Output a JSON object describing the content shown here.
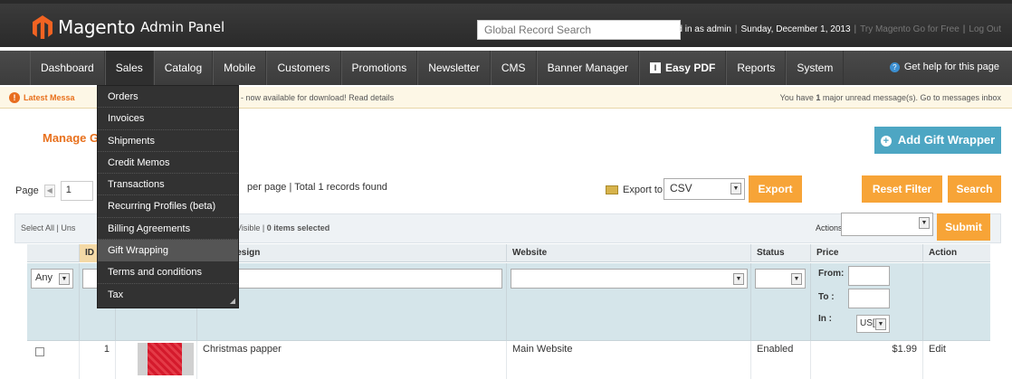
{
  "header": {
    "brand": "Magento",
    "brand_sub": "Admin Panel",
    "global_search_placeholder": "Global Record Search",
    "logged_in": "Logged in as admin",
    "date": "Sunday, December 1, 2013",
    "try_link": "Try Magento Go for Free",
    "logout": "Log Out"
  },
  "nav": {
    "items": [
      "Dashboard",
      "Sales",
      "Catalog",
      "Mobile",
      "Customers",
      "Promotions",
      "Newsletter",
      "CMS",
      "Banner Manager",
      "Easy PDF",
      "Reports",
      "System"
    ],
    "help": "Get help for this page"
  },
  "messages": {
    "latest": "Latest Messa",
    "middle": "- now available for download! Read details",
    "right_pre": "You have ",
    "right_count": "1",
    "right_post": " major unread message(s). Go to messages inbox"
  },
  "sales_menu": {
    "items": [
      "Orders",
      "Invoices",
      "Shipments",
      "Credit Memos",
      "Transactions",
      "Recurring Profiles (beta)",
      "Billing Agreements",
      "Gift Wrapping",
      "Terms and conditions",
      "Tax"
    ],
    "hovered": "Gift Wrapping"
  },
  "page": {
    "title": "Manage G",
    "add_button": "Add Gift Wrapper"
  },
  "toolbar": {
    "page_label": "Page",
    "page_value": "1",
    "per_page_text": "per page | Total 1 records found",
    "export_label": "Export to:",
    "export_value": "CSV",
    "export_button": "Export",
    "reset_button": "Reset Filter",
    "search_button": "Search"
  },
  "massaction": {
    "left": "Select All | Uns",
    "visible": "Visible | ",
    "selected_count": "0",
    "selected_text": " items selected",
    "actions_label": "Actions",
    "submit": "Submit"
  },
  "grid": {
    "columns": {
      "id": "ID",
      "design": "pping Design",
      "website": "Website",
      "status": "Status",
      "price": "Price",
      "action": "Action"
    },
    "filter": {
      "any": "Any",
      "from": "From:",
      "to": "To :",
      "in": "In :",
      "currency": "US["
    },
    "rows": [
      {
        "id": "1",
        "design": "Christmas papper",
        "website": "Main Website",
        "status": "Enabled",
        "price": "$1.99",
        "action": "Edit"
      }
    ]
  }
}
